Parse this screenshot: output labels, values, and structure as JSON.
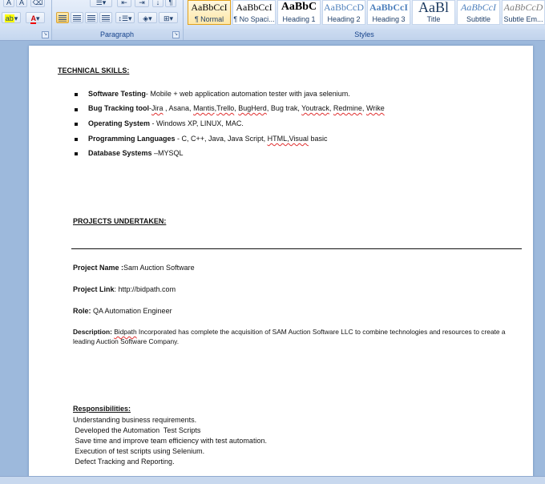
{
  "ribbon": {
    "paragraph_label": "Paragraph",
    "styles_label": "Styles",
    "styles": [
      {
        "sample": "AaBbCcI",
        "name": "¶ Normal"
      },
      {
        "sample": "AaBbCcI",
        "name": "¶ No Spaci..."
      },
      {
        "sample": "AaBbC",
        "name": "Heading 1"
      },
      {
        "sample": "AaBbCcD",
        "name": "Heading 2"
      },
      {
        "sample": "AaBbCcI",
        "name": "Heading 3"
      },
      {
        "sample": "AaBl",
        "name": "Title"
      },
      {
        "sample": "AaBbCcI",
        "name": "Subtitle"
      },
      {
        "sample": "AaBbCcD",
        "name": "Subtle Em..."
      }
    ],
    "font_buttons": {
      "bold": "A",
      "italic": "A",
      "font_color": "A",
      "highlight": "ab"
    }
  },
  "doc": {
    "skills_heading": "TECHNICAL SKILLS:",
    "skills": [
      {
        "label": "Software Testing",
        "text": "- Mobile + web application automation tester with java selenium."
      },
      {
        "label": "Bug Tracking  tool",
        "text_pre": "-",
        "links": [
          "Jira",
          " ,  Asana,  ",
          "Mantis",
          ",",
          "Trello",
          ",  ",
          "BugHerd",
          ", Bug trak, ",
          "Youtrack",
          ", ",
          "Redmine",
          ",  ",
          "Wrike"
        ]
      },
      {
        "label": "Operating System",
        "text": " - Windows XP, LINUX, MAC."
      },
      {
        "label": "Programming Languages",
        "text_pre": "  - C, C++, Java, Java Script, ",
        "squig": "HTML,Visual",
        "text_post": "  basic"
      },
      {
        "label": "Database  Systems",
        "text": " –MYSQL"
      }
    ],
    "projects_heading": "PROJECTS UNDERTAKEN:",
    "project_name_label": "Project Name :",
    "project_name_value": "Sam Auction Software",
    "project_link_label": "Project Link",
    "project_link_value": ": http://bidpath.com",
    "role_label": "Role:",
    "role_value": "  QA Automation  Engineer",
    "description_label": "Description:",
    "description_line1_squig": "Bidpath",
    "description_line1": " Incorporated has complete the acquisition of SAM Auction Software LLC to combine technologies and resources to create a",
    "description_line2": "leading Auction Software Company.",
    "responsibilities_heading": "Responsibilities:",
    "responsibilities": [
      "Understanding business requirements.",
      " Developed the Automation  Test Scripts",
      " Save time and improve team efficiency with test automation.",
      " Execution of test scripts using Selenium.",
      " Defect Tracking and Reporting."
    ]
  }
}
